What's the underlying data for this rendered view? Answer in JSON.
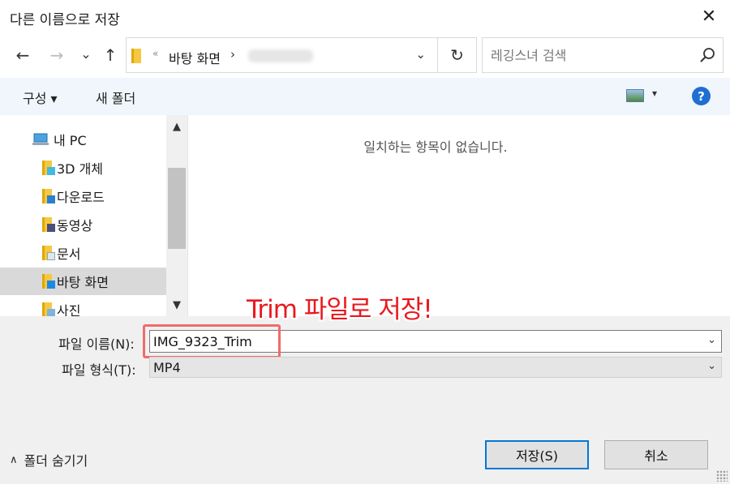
{
  "window": {
    "title": "다른 이름으로 저장",
    "close": "✕"
  },
  "nav": {
    "back": "←",
    "forward": "→",
    "recent": "⌄",
    "up": "↑",
    "address": {
      "separator": "«",
      "location": "바탕 화면",
      "arrow": "›",
      "dropdown": "⌄"
    },
    "refresh": "↻",
    "search": {
      "placeholder": "레깅스녀 검색"
    }
  },
  "toolbar": {
    "organize": "구성 ▾",
    "new_folder": "새 폴더",
    "view_dropdown": "▾",
    "help": "?"
  },
  "sidebar": {
    "items": [
      {
        "label": "내 PC",
        "icon": "computer-icon"
      },
      {
        "label": "3D 개체",
        "icon": "3d-objects-folder-icon"
      },
      {
        "label": "다운로드",
        "icon": "downloads-folder-icon"
      },
      {
        "label": "동영상",
        "icon": "videos-folder-icon"
      },
      {
        "label": "문서",
        "icon": "documents-folder-icon"
      },
      {
        "label": "바탕 화면",
        "icon": "desktop-folder-icon"
      },
      {
        "label": "사진",
        "icon": "pictures-folder-icon"
      }
    ],
    "scroll_up": "▲",
    "scroll_down": "▼"
  },
  "content": {
    "empty_message": "일치하는 항목이 없습니다."
  },
  "form": {
    "filename_label": "파일 이름(N):",
    "filename_value": "IMG_9323_Trim",
    "filetype_label": "파일 형식(T):",
    "filetype_value": "MP4",
    "dropdown": "⌄"
  },
  "annotation": {
    "text": "Trim 파일로 저장!",
    "color": "#e8191f"
  },
  "footer": {
    "hide_folders": "폴더 숨기기",
    "hide_chevron": "∧",
    "save": "저장(S)",
    "cancel": "취소"
  },
  "colors": {
    "toolbar_bg": "#f0f6fb",
    "accent": "#0078d7",
    "highlight_border": "#f06b6b"
  }
}
